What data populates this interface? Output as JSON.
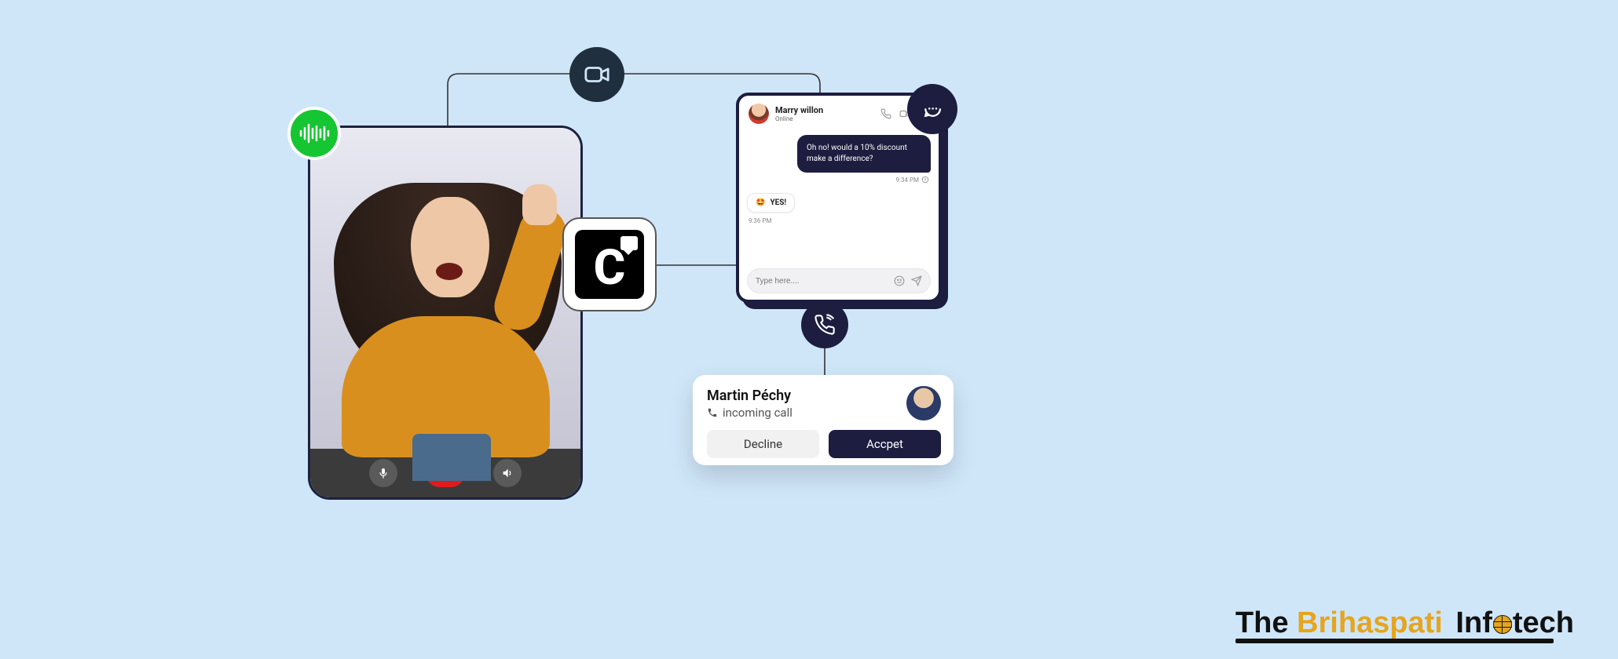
{
  "badges": {
    "audio": "audio-wave-icon",
    "camera": "camera-icon",
    "chat": "chat-bubble-icon",
    "phone": "phone-icon"
  },
  "center_logo": {
    "letter": "C"
  },
  "video_card": {
    "controls": {
      "mic": "mic-icon",
      "hangup": "hangup-icon",
      "speaker": "speaker-icon"
    }
  },
  "chat": {
    "user": {
      "name": "Marry willon",
      "status": "Online"
    },
    "header_icons": {
      "call": "phone-icon",
      "video": "video-icon",
      "info": "info-icon"
    },
    "messages": {
      "them": {
        "text": "Oh no! would a 10% discount make a difference?",
        "time": "9:34 PM"
      },
      "me": {
        "emoji": "🤩",
        "text": "YES!",
        "time": "9:36 PM"
      }
    },
    "input": {
      "placeholder": "Type here....",
      "emoji_btn": "emoji-icon",
      "send_btn": "send-icon"
    }
  },
  "call": {
    "name": "Martin Péchy",
    "status": "incoming call",
    "decline_label": "Decline",
    "accept_label": "Accpet"
  },
  "brand": {
    "part1": "The",
    "part2": "Brihaspati",
    "part3_a": "Inf",
    "part3_b": "tech"
  },
  "colors": {
    "bg": "#cfe6f9",
    "dark_navy": "#1c1d3f",
    "green": "#15c531",
    "red": "#e11b1b",
    "orange": "#e6a51e"
  }
}
